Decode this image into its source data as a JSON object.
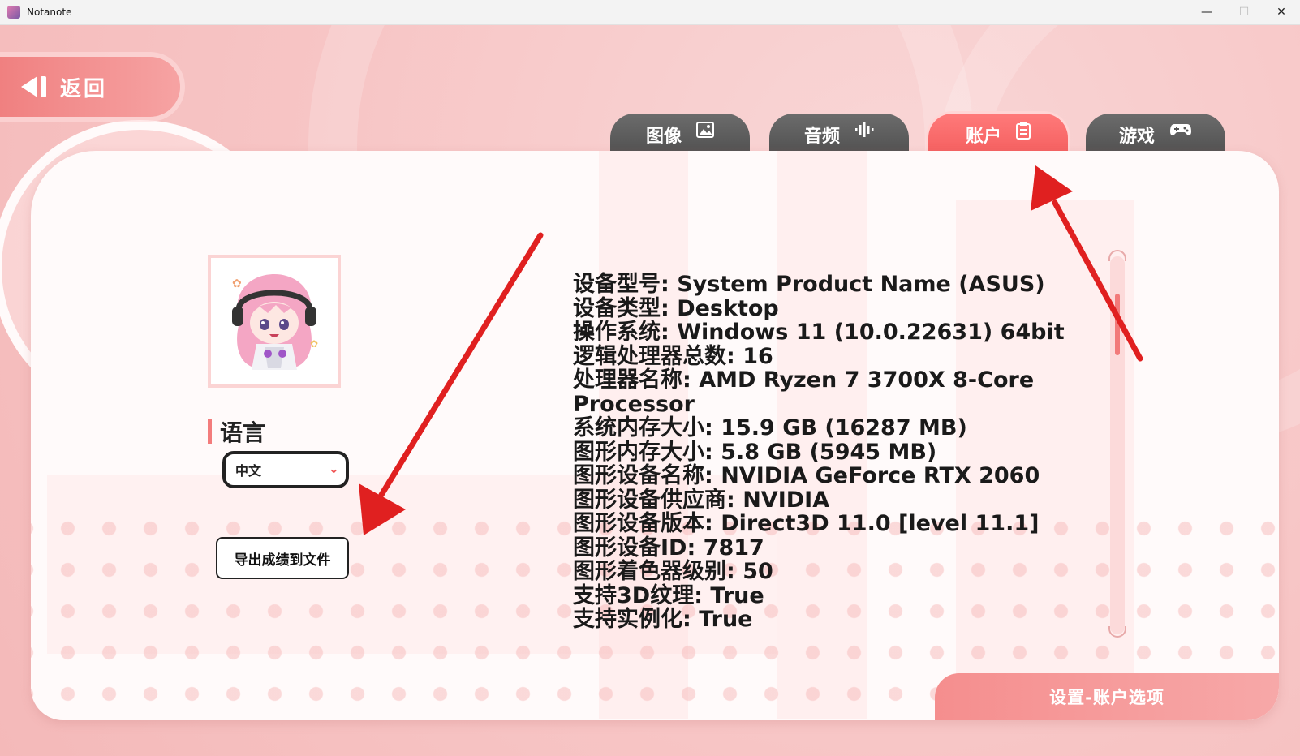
{
  "window": {
    "title": "Notanote",
    "controls": {
      "minimize": "—",
      "maximize": "☐",
      "close": "✕"
    }
  },
  "back": {
    "label": "返回"
  },
  "tabs": [
    {
      "label": "图像",
      "icon": "image-icon",
      "glyph": "▨",
      "active": false
    },
    {
      "label": "音频",
      "icon": "audio-wave-icon",
      "glyph": "ıllı",
      "active": false
    },
    {
      "label": "账户",
      "icon": "clipboard-icon",
      "glyph": "▤",
      "active": true
    },
    {
      "label": "游戏",
      "icon": "gamepad-icon",
      "glyph": "🎮",
      "active": false
    }
  ],
  "language": {
    "title": "语言",
    "selected": "中文",
    "chevron": "⌄"
  },
  "export": {
    "label": "导出成绩到文件"
  },
  "system_info": [
    "设备型号: System Product Name (ASUS)",
    "设备类型: Desktop",
    "操作系统: Windows 11  (10.0.22631) 64bit",
    "逻辑处理器总数: 16",
    "处理器名称: AMD Ryzen 7 3700X 8-Core Processor",
    "系统内存大小: 15.9 GB (16287 MB)",
    "图形内存大小: 5.8 GB (5945 MB)",
    "图形设备名称: NVIDIA GeForce RTX 2060",
    "图形设备供应商: NVIDIA",
    "图形设备版本: Direct3D 11.0 [level 11.1]",
    "图形设备ID: 7817",
    "图形着色器级别: 50",
    "支持3D纹理: True",
    "支持实例化: True"
  ],
  "footer": {
    "label": "设置-账户选项"
  },
  "colors": {
    "accent": "#f25a5a",
    "panel": "#fffafa",
    "background": "#f7c5c5",
    "annotation": "#e02020"
  }
}
